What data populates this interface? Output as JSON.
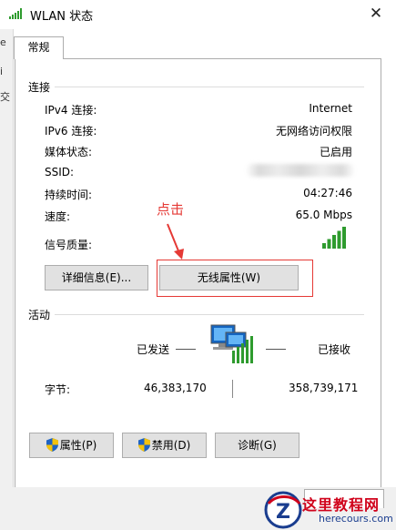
{
  "window": {
    "title": "WLAN 状态",
    "close_glyph": "✕"
  },
  "background_sliver": [
    "e",
    "i",
    "交"
  ],
  "tabs": [
    {
      "label": "常规"
    }
  ],
  "connection": {
    "group_title": "连接",
    "rows": [
      {
        "label": "IPv4 连接:",
        "value": "Internet"
      },
      {
        "label": "IPv6 连接:",
        "value": "无网络访问权限"
      },
      {
        "label": "媒体状态:",
        "value": "已启用"
      },
      {
        "label": "SSID:",
        "value": ""
      },
      {
        "label": "持续时间:",
        "value": "04:27:46"
      },
      {
        "label": "速度:",
        "value": "65.0 Mbps"
      },
      {
        "label": "信号质量:",
        "value": ""
      }
    ],
    "signal_bars_lit": 5,
    "signal_bars_total": 5
  },
  "buttons": {
    "details": "详细信息(E)...",
    "wireless_properties": "无线属性(W)",
    "properties": "属性(P)",
    "disable": "禁用(D)",
    "diagnose": "诊断(G)"
  },
  "annotation": {
    "text": "点击",
    "color": "#e53935"
  },
  "activity": {
    "group_title": "活动",
    "sent_label": "已发送",
    "received_label": "已接收",
    "bytes_label": "字节:",
    "bytes_sent": "46,383,170",
    "bytes_received": "358,739,171"
  },
  "watermark": {
    "cn": "这里教程网",
    "en": "herecours.com",
    "logo_letter": "Z"
  },
  "icons": {
    "title": "wifi-signal-icon",
    "signal": "signal-strength-icon",
    "network": "network-computers-icon",
    "shield": "uac-shield-icon"
  },
  "colors": {
    "signal_green": "#2e9b2e",
    "annotation_red": "#e53935",
    "button_bg": "#e1e1e1",
    "watermark_red": "#d0021b",
    "watermark_blue": "#1a3d8f"
  }
}
